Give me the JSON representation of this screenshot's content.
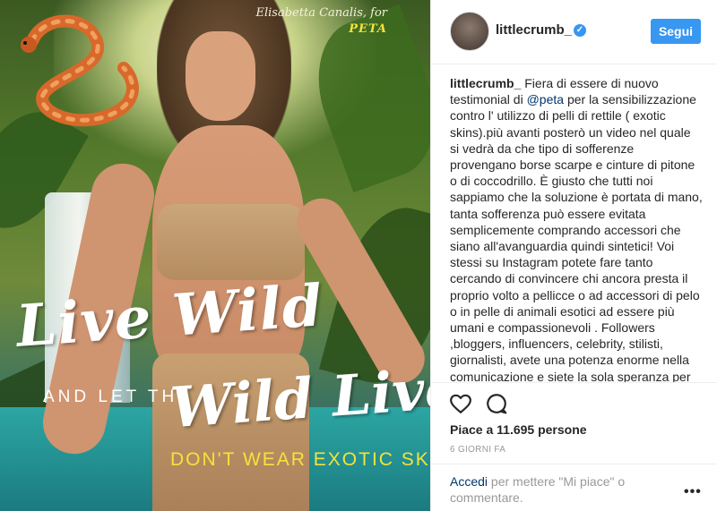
{
  "image": {
    "credit_name": "Elisabetta Canalis, for",
    "credit_brand": "PETA",
    "headline_1": "Live Wild",
    "headline_2": "AND LET THE",
    "headline_3": "Wild Live",
    "tagline": "DON'T WEAR EXOTIC SKINS."
  },
  "header": {
    "username": "littlecrumb_",
    "verified_icon": "verified-badge-icon",
    "follow_label": "Segui"
  },
  "caption": {
    "username": "littlecrumb_",
    "part1": " Fiera di essere di nuovo testimonial di ",
    "mention": "@peta",
    "part2": " per la sensibilizzazione contro l' utilizzo di pelli di rettile ( exotic skins).più avanti posterò un video nel quale si vedrà da che tipo di sofferenze provengano borse scarpe e cinture di pitone o di coccodrillo. È giusto che tutti noi sappiamo che la soluzione è portata di mano, tanta sofferenza può essere evitata semplicemente comprando accessori che siano all'avanguardia quindi sintetici! Voi stessi su Instagram potete fare tanto cercando di convincere chi ancora presta il proprio volto a pellicce o ad accessori di pelo o in pelle di animali esotici ad essere più umani e compassionevoli . Followers ,bloggers, influencers, celebrity, stilisti, giornalisti, avete una potenza enorme nella comunicazione e siete la sola speranza per"
  },
  "actions": {
    "like_icon": "heart-icon",
    "comment_icon": "comment-bubble-icon",
    "likes_text": "Piace a 11.695 persone",
    "time_text": "6 GIORNI FA"
  },
  "comment_bar": {
    "login_link": "Accedi",
    "login_text": " per mettere \"Mi piace\" o commentare.",
    "more_label": "•••"
  },
  "colors": {
    "accent": "#3897f0",
    "link": "#003569",
    "tagline_yellow": "#f5e23a"
  }
}
